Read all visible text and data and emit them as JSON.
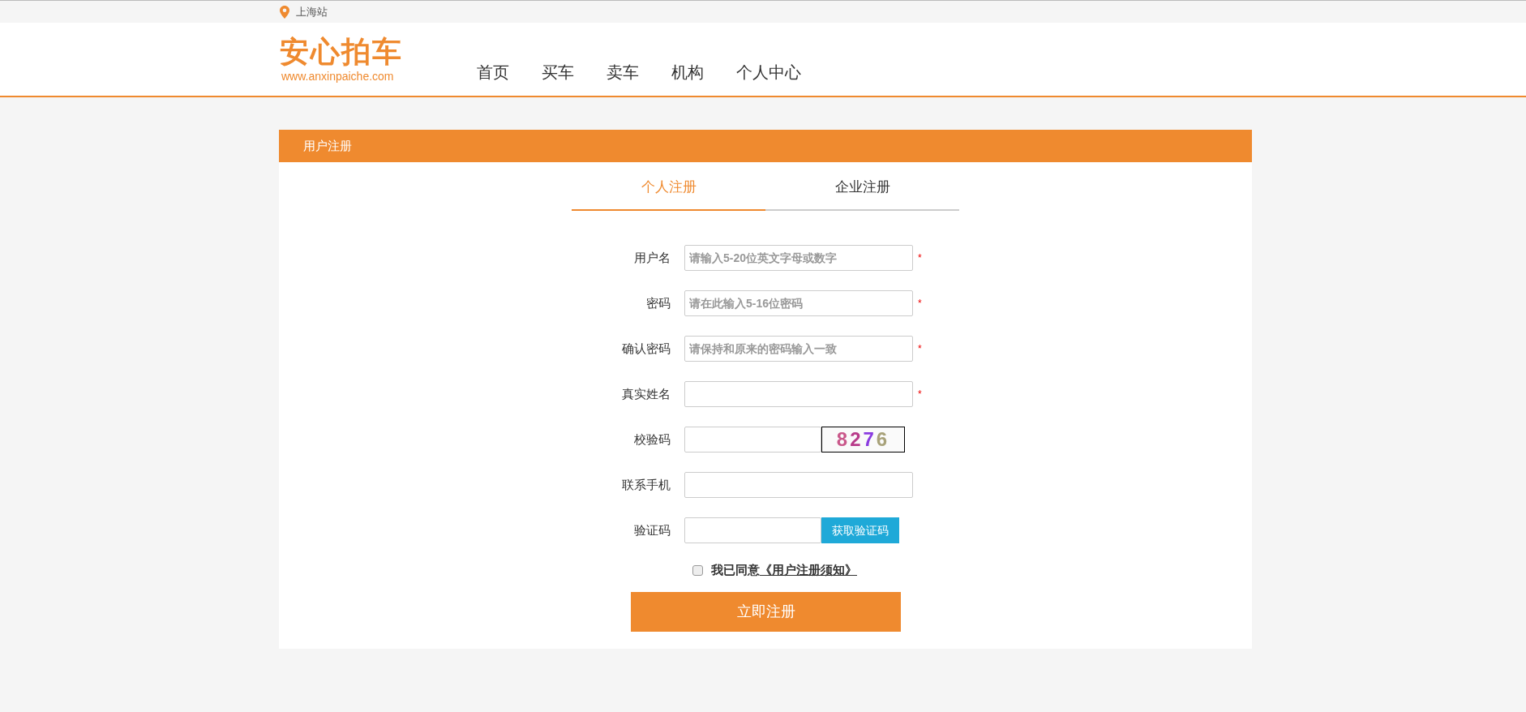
{
  "top_bar": {
    "location": "上海站"
  },
  "header": {
    "logo": "安心拍车",
    "logo_url": "www.anxinpaiche.com",
    "nav": [
      {
        "label": "首页"
      },
      {
        "label": "买车"
      },
      {
        "label": "卖车"
      },
      {
        "label": "机构"
      },
      {
        "label": "个人中心"
      }
    ]
  },
  "panel": {
    "title": "用户注册",
    "tabs": [
      {
        "label": "个人注册",
        "selected": true
      },
      {
        "label": "企业注册",
        "selected": false
      }
    ],
    "fields": [
      {
        "kind": "text",
        "label": "用户名",
        "placeholder": "请输入5-20位英文字母或数字",
        "mark": "*"
      },
      {
        "kind": "text",
        "label": "密码",
        "placeholder": "请在此输入5-16位密码",
        "mark": "*"
      },
      {
        "kind": "text",
        "label": "确认密码",
        "placeholder": "请保持和原来的密码输入一致",
        "mark": "*"
      },
      {
        "kind": "text",
        "label": "真实姓名",
        "mark": "*"
      },
      {
        "kind": "captcha",
        "label": "校验码",
        "captcha": "8276"
      },
      {
        "kind": "text",
        "label": "联系手机"
      },
      {
        "kind": "sms",
        "label": "验证码",
        "button": "获取验证码"
      }
    ],
    "agreement": {
      "checked": false,
      "text": "我已同意",
      "link": "《用户注册须知》"
    },
    "submit": "立即注册"
  }
}
